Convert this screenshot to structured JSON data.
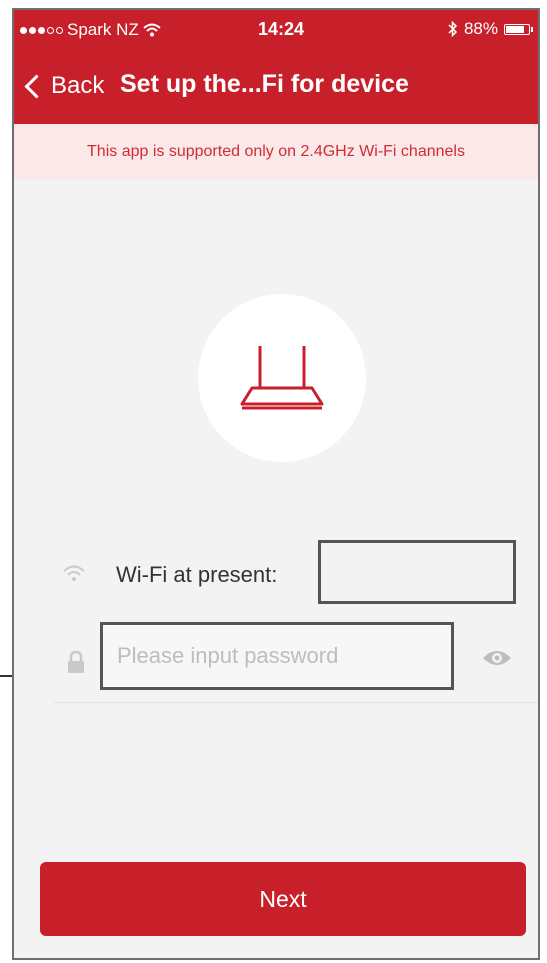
{
  "status_bar": {
    "carrier": "Spark NZ",
    "time": "14:24",
    "battery": "88%",
    "battery_level": 0.88
  },
  "nav": {
    "back_label": "Back",
    "title": "Set up the...Fi for device"
  },
  "notice": {
    "text": "This app is supported only on 2.4GHz Wi-Fi channels"
  },
  "wifi": {
    "label": "Wi-Fi at present:",
    "value": ""
  },
  "password": {
    "placeholder": "Please input password",
    "value": ""
  },
  "actions": {
    "next_label": "Next"
  },
  "colors": {
    "brand_red": "#c8202b",
    "notice_bg": "#fbe9e9",
    "notice_text": "#d42a33",
    "background": "#f3f3f3"
  },
  "icons": {
    "back": "chevron-left-icon",
    "router": "router-icon",
    "wifi": "wifi-icon",
    "lock": "lock-icon",
    "eye": "eye-icon",
    "bluetooth": "bluetooth-icon",
    "battery": "battery-icon"
  }
}
